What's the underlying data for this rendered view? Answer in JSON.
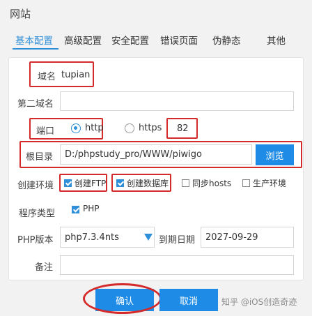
{
  "window": {
    "title": "网站"
  },
  "tabs": [
    {
      "label": "基本配置"
    },
    {
      "label": "高级配置"
    },
    {
      "label": "安全配置"
    },
    {
      "label": "错误页面"
    },
    {
      "label": "伪静态"
    },
    {
      "label": "其他"
    }
  ],
  "form": {
    "domain": {
      "label": "域名",
      "value": "tupian"
    },
    "second_domain": {
      "label": "第二域名",
      "value": ""
    },
    "port": {
      "label": "端口",
      "options": [
        {
          "label": "http",
          "selected": true
        },
        {
          "label": "https",
          "selected": false
        }
      ],
      "value": "82"
    },
    "root": {
      "label": "根目录",
      "value": "D:/phpstudy_pro/WWW/piwigo",
      "browse_label": "浏览"
    },
    "env": {
      "label": "创建环境",
      "options": [
        {
          "label": "创建FTP",
          "checked": true
        },
        {
          "label": "创建数据库",
          "checked": true
        },
        {
          "label": "同步hosts",
          "checked": false
        },
        {
          "label": "生产环境",
          "checked": false
        }
      ]
    },
    "program": {
      "label": "程序类型",
      "options": [
        {
          "label": "PHP",
          "checked": true
        }
      ]
    },
    "php": {
      "label": "PHP版本",
      "value": "php7.3.4nts"
    },
    "expire": {
      "label": "到期日期",
      "value": "2027-09-29"
    },
    "remark": {
      "label": "备注",
      "value": ""
    }
  },
  "actions": {
    "confirm_label": "确认",
    "cancel_label": "取消"
  },
  "watermark": "知乎 @iOS创造奇迹",
  "colors": {
    "accent": "#1e8ce6",
    "annotation": "#d42a2a"
  }
}
